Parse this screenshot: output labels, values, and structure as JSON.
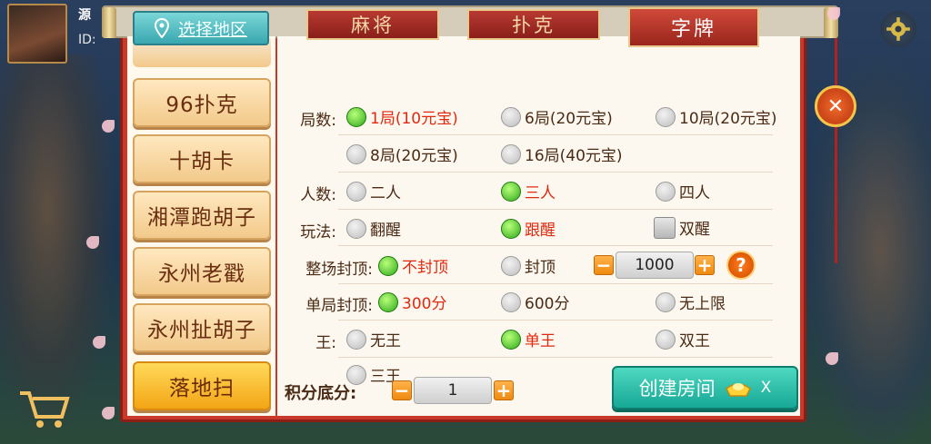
{
  "header": {
    "user_name": "源",
    "user_id": "ID:"
  },
  "region_button": {
    "label": "选择地区"
  },
  "tabs": [
    {
      "label": "麻将",
      "active": false
    },
    {
      "label": "扑克",
      "active": false
    },
    {
      "label": "字牌",
      "active": true
    }
  ],
  "sidebar": {
    "items": [
      {
        "label": "96扑克",
        "selected": false
      },
      {
        "label": "十胡卡",
        "selected": false
      },
      {
        "label": "湘潭跑胡子",
        "selected": false
      },
      {
        "label": "永州老戳",
        "selected": false
      },
      {
        "label": "永州扯胡子",
        "selected": false
      },
      {
        "label": "落地扫",
        "selected": true
      }
    ]
  },
  "settings": {
    "rounds": {
      "label": "局数:",
      "options": [
        "1局(10元宝)",
        "6局(20元宝)",
        "10局(20元宝)",
        "8局(20元宝)",
        "16局(40元宝)"
      ],
      "selected": 0
    },
    "players": {
      "label": "人数:",
      "options": [
        "二人",
        "三人",
        "四人"
      ],
      "selected": 1
    },
    "play": {
      "label": "玩法:",
      "options": [
        "翻醒",
        "跟醒",
        "双醒"
      ],
      "selected": 1
    },
    "cap_total": {
      "label": "整场封顶:",
      "options": [
        "不封顶",
        "封顶"
      ],
      "selected": 0,
      "stepper_value": "1000"
    },
    "cap_round": {
      "label": "单局封顶:",
      "options": [
        "300分",
        "600分",
        "无上限"
      ],
      "selected": 0
    },
    "king": {
      "label": "王:",
      "options": [
        "无王",
        "单王",
        "双王",
        "三王"
      ],
      "selected": 1
    }
  },
  "score": {
    "label": "积分底分:",
    "value": "1"
  },
  "create_button": {
    "label": "创建房间",
    "cost": "X"
  },
  "colors": {
    "panel_red": "#c8392b",
    "accent_green": "#2ea81a",
    "create_teal": "#17a896",
    "selected_text": "#e02a10"
  }
}
